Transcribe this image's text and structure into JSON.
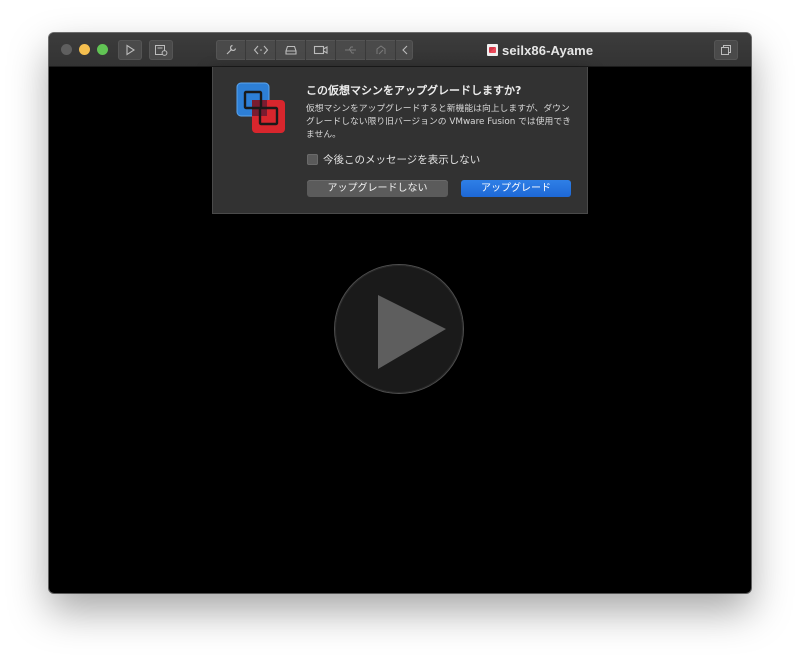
{
  "window": {
    "title": "seilx86-Ayame"
  },
  "toolbar": {
    "buttons": [
      {
        "icon": "play-icon"
      },
      {
        "icon": "snapshot-icon"
      },
      {
        "icon": "settings-wrench-icon"
      },
      {
        "icon": "code-brackets-icon"
      },
      {
        "icon": "hard-disk-icon"
      },
      {
        "icon": "camera-icon"
      },
      {
        "icon": "usb-icon"
      },
      {
        "icon": "network-disconnected-icon"
      },
      {
        "icon": "chevron-left-icon"
      },
      {
        "icon": "window-unity-icon"
      }
    ]
  },
  "dialog": {
    "title": "この仮想マシンをアップグレードしますか?",
    "body": "仮想マシンをアップグレードすると新機能は向上しますが、ダウングレードしない限り旧バージョンの VMware Fusion では使用できません。",
    "checkbox_label": "今後このメッセージを表示しない",
    "checkbox_checked": false,
    "secondary_button": "アップグレードしない",
    "primary_button": "アップグレード"
  },
  "colors": {
    "primary_button": "#1e68d6",
    "traffic_close": "#5f5f5f",
    "traffic_min": "#f5bf4f",
    "traffic_max": "#61c454"
  }
}
